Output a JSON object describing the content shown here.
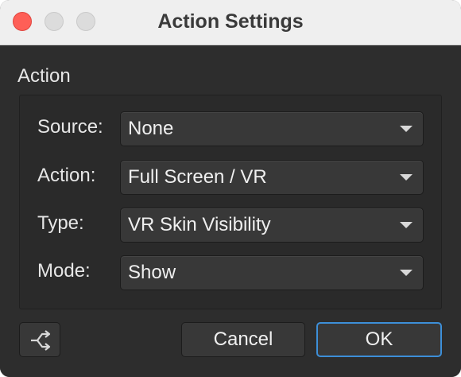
{
  "window": {
    "title": "Action Settings"
  },
  "group": {
    "title": "Action"
  },
  "rows": [
    {
      "label": "Source:",
      "value": "None"
    },
    {
      "label": "Action:",
      "value": "Full Screen / VR"
    },
    {
      "label": "Type:",
      "value": "VR Skin Visibility"
    },
    {
      "label": "Mode:",
      "value": "Show"
    }
  ],
  "buttons": {
    "icon": "branch-arrow-icon",
    "cancel_label": "Cancel",
    "ok_label": "OK"
  },
  "colors": {
    "close": "#fe5f57",
    "focus_ring": "#3d8fd8"
  }
}
